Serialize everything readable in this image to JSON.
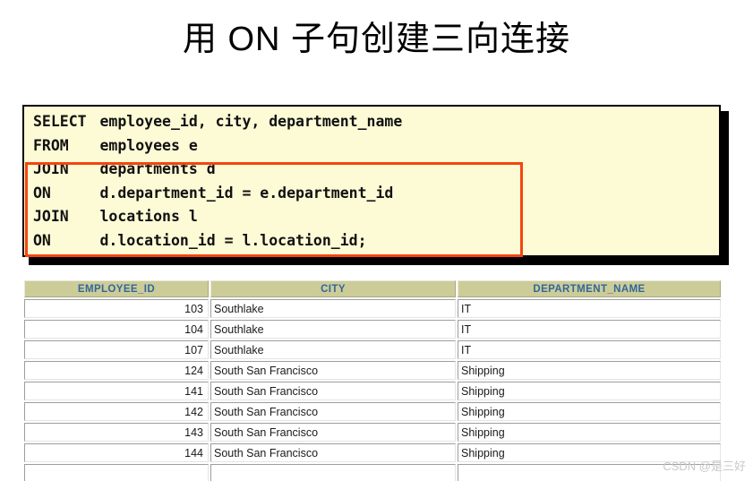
{
  "slide": {
    "title": "用 ON 子句创建三向连接"
  },
  "code_block": {
    "background_color": "#fdfbd6",
    "highlight_color": "#f4450f",
    "lines": [
      {
        "keyword": "SELECT",
        "rest": "employee_id, city, department_name",
        "highlighted": false
      },
      {
        "keyword": "FROM",
        "rest": "employees e",
        "highlighted": false
      },
      {
        "keyword": "JOIN",
        "rest": "departments d",
        "highlighted": true
      },
      {
        "keyword": "ON",
        "rest": "d.department_id = e.department_id",
        "highlighted": true
      },
      {
        "keyword": "JOIN",
        "rest": "locations l",
        "highlighted": true
      },
      {
        "keyword": "ON",
        "rest": "d.location_id = l.location_id;",
        "highlighted": true
      }
    ]
  },
  "result_grid": {
    "header_background": "#cccc99",
    "header_text_color": "#336699",
    "columns": [
      "EMPLOYEE_ID",
      "CITY",
      "DEPARTMENT_NAME"
    ],
    "rows": [
      [
        "103",
        "Southlake",
        "IT"
      ],
      [
        "104",
        "Southlake",
        "IT"
      ],
      [
        "107",
        "Southlake",
        "IT"
      ],
      [
        "124",
        "South San Francisco",
        "Shipping"
      ],
      [
        "141",
        "South San Francisco",
        "Shipping"
      ],
      [
        "142",
        "South San Francisco",
        "Shipping"
      ],
      [
        "143",
        "South San Francisco",
        "Shipping"
      ],
      [
        "144",
        "South San Francisco",
        "Shipping"
      ],
      [
        "",
        "",
        ""
      ]
    ]
  },
  "watermark": {
    "text": "CSDN @是三好"
  }
}
